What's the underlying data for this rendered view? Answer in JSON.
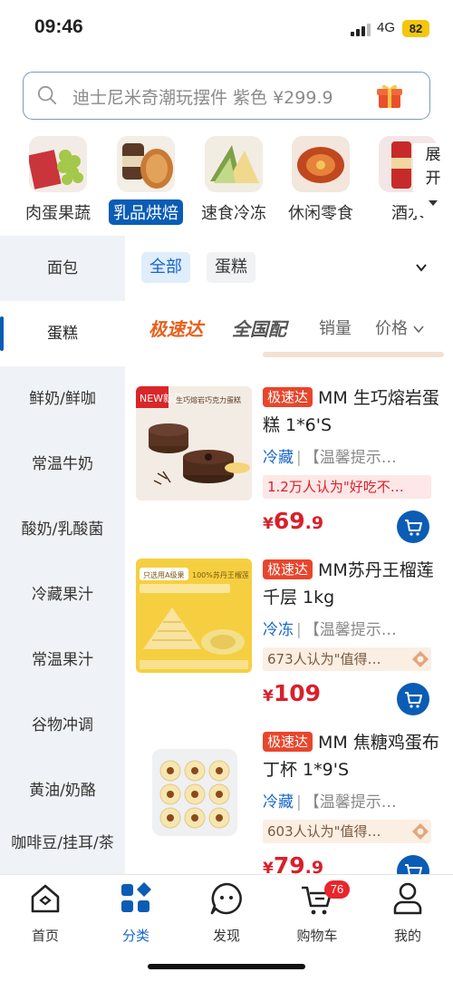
{
  "status": {
    "time": "09:46",
    "network": "4G",
    "battery": "82"
  },
  "search": {
    "placeholder": "迪士尼米奇潮玩摆件 紫色 ¥299.9"
  },
  "categories": [
    "肉蛋果蔬",
    "乳品烘焙",
    "速食冷冻",
    "休闲零食",
    "酒水"
  ],
  "expand_label": "展开",
  "sidebar": [
    "面包",
    "蛋糕",
    "鲜奶/鲜咖",
    "常温牛奶",
    "酸奶/乳酸菌",
    "冷藏果汁",
    "常温果汁",
    "谷物冲调",
    "黄油/奶酪",
    "咖啡豆/挂耳/茶"
  ],
  "filters": {
    "all": "全部",
    "cake": "蛋糕"
  },
  "sorts": {
    "express": "极速达",
    "national": "全国配",
    "sales": "销量",
    "price": "价格"
  },
  "products": [
    {
      "tag": "极速达",
      "title": "MM 生巧熔岩蛋糕 1*6'S",
      "temp": "冷藏",
      "sep": "|",
      "warn": "【温馨提示…",
      "rank": "1.2万人认为\"好吃不…",
      "cur": "¥",
      "price": "69",
      "dec": ".9",
      "img_badge": "NEW新品",
      "img_text": "生巧熔岩巧克力蛋糕"
    },
    {
      "tag": "极速达",
      "title": "MM苏丹王榴莲千层 1kg",
      "temp": "冷冻",
      "sep": "|",
      "warn": "【温馨提示…",
      "rank": "673人认为\"值得…",
      "cur": "¥",
      "price": "109",
      "dec": "",
      "img_badge": "只选用A级果",
      "img_text": "100%苏丹王榴莲"
    },
    {
      "tag": "极速达",
      "title": "MM 焦糖鸡蛋布丁杯 1*9'S",
      "temp": "冷藏",
      "sep": "|",
      "warn": "【温馨提示…",
      "rank": "603人认为\"值得…",
      "cur": "¥",
      "price": "79",
      "dec": ".9",
      "img_badge": "",
      "img_text": ""
    }
  ],
  "tabs": [
    {
      "label": "首页"
    },
    {
      "label": "分类"
    },
    {
      "label": "发现"
    },
    {
      "label": "购物车",
      "badge": "76"
    },
    {
      "label": "我的"
    }
  ]
}
